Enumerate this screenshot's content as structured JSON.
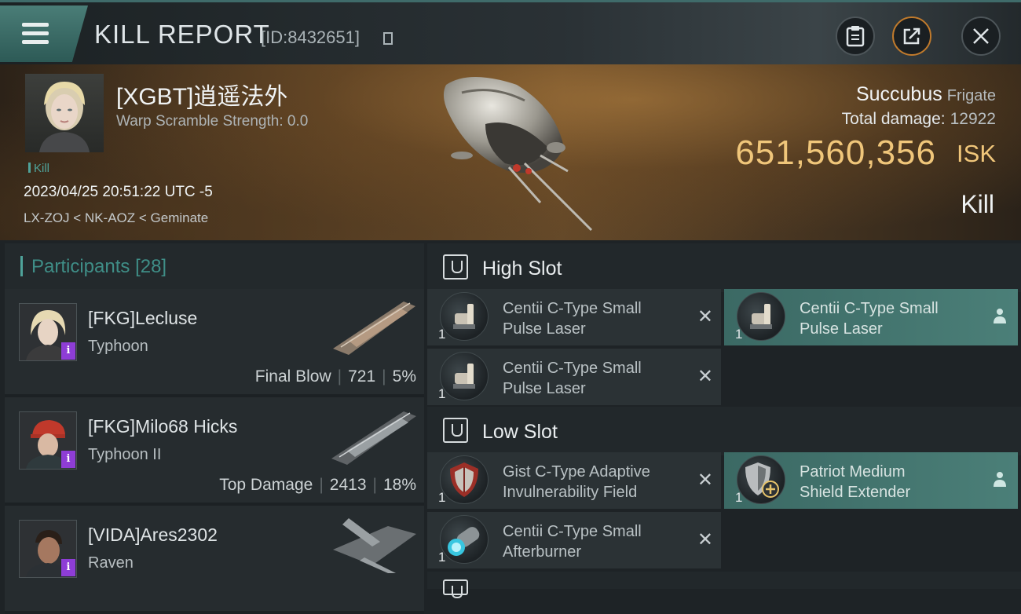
{
  "header": {
    "title": "KILL REPORT",
    "report_id": "[ID:8432651]",
    "icons": [
      "menu-icon",
      "copy-icon",
      "clipboard-icon",
      "share-icon",
      "close-icon"
    ]
  },
  "victim": {
    "name": "[XGBT]逍遥法外",
    "warp_scramble": "Warp Scramble Strength: 0.0",
    "tag": "Kill",
    "timestamp": "2023/04/25 20:51:22 UTC -5",
    "location": "LX-ZOJ < NK-AOZ < Geminate",
    "ship_name": "Succubus",
    "ship_class": "Frigate",
    "total_damage_label": "Total damage:",
    "total_damage": "12922",
    "isk_value": "651,560,356",
    "isk_unit": "ISK",
    "result": "Kill"
  },
  "participants": {
    "title": "Participants",
    "count": "[28]",
    "rows": [
      {
        "name": "[FKG]Lecluse",
        "ship": "Typhoon",
        "role": "Final Blow",
        "damage": "721",
        "percent": "5%",
        "badge": "i"
      },
      {
        "name": "[FKG]Milo68 Hicks",
        "ship": "Typhoon II",
        "role": "Top Damage",
        "damage": "2413",
        "percent": "18%",
        "badge": "i"
      },
      {
        "name": "[VIDA]Ares2302",
        "ship": "Raven",
        "badge": "i"
      }
    ]
  },
  "fitting": {
    "high_slot": {
      "title": "High Slot",
      "modules": [
        {
          "qty": "1",
          "name": "Centii C-Type Small Pulse Laser",
          "line1": "Centii C-Type Small",
          "line2": "Pulse Laser",
          "state": "destroyed"
        },
        {
          "qty": "1",
          "name": "Centii C-Type Small Pulse Laser",
          "line1": "Centii C-Type Small",
          "line2": "Pulse Laser",
          "state": "dropped"
        },
        {
          "qty": "1",
          "name": "Centii C-Type Small Pulse Laser",
          "line1": "Centii C-Type Small",
          "line2": "Pulse Laser",
          "state": "destroyed"
        }
      ]
    },
    "low_slot": {
      "title": "Low Slot",
      "modules": [
        {
          "qty": "1",
          "line1": "Gist C-Type Adaptive",
          "line2": "Invulnerability Field",
          "state": "destroyed"
        },
        {
          "qty": "1",
          "line1": "Patriot Medium",
          "line2": "Shield Extender",
          "state": "dropped"
        },
        {
          "qty": "1",
          "line1": "Centii C-Type Small",
          "line2": "Afterburner",
          "state": "destroyed"
        }
      ]
    }
  },
  "colors": {
    "accent_teal": "#4fa39a",
    "isk_gold": "#f0c67a",
    "badge_purple": "#8e3dd6",
    "share_orange": "#c07a2c"
  }
}
